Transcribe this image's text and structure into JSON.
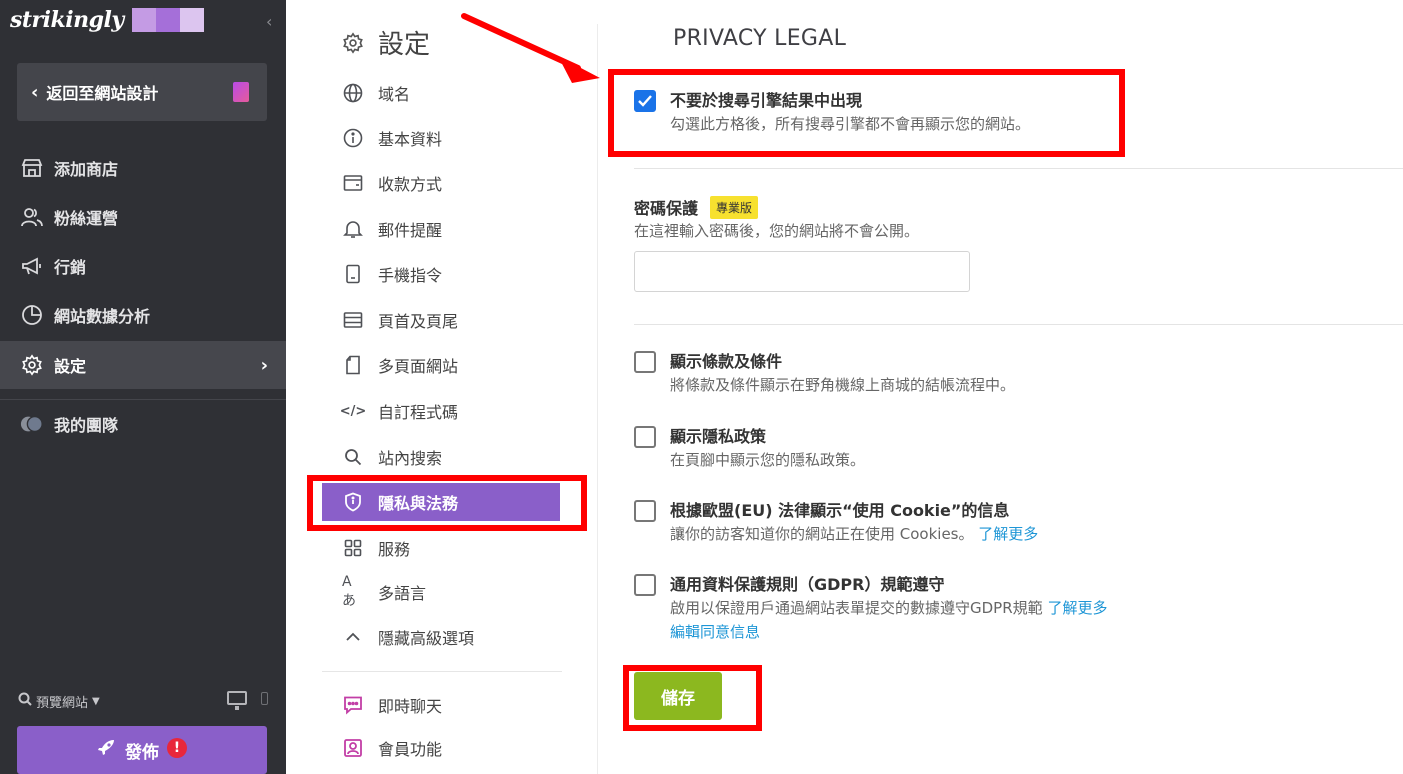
{
  "brand": {
    "logo_text": "strikingly",
    "logo_colors": [
      "#c49be4",
      "#a56fd9",
      "#dcc5ef"
    ]
  },
  "sidebar": {
    "back_label": "返回至網站設計",
    "items": [
      {
        "label": "添加商店",
        "icon": "store-icon"
      },
      {
        "label": "粉絲運營",
        "icon": "audience-icon"
      },
      {
        "label": "行銷",
        "icon": "megaphone-icon"
      },
      {
        "label": "網站數據分析",
        "icon": "pie-chart-icon"
      },
      {
        "label": "設定",
        "icon": "gear-icon",
        "active": true
      },
      {
        "label": "我的團隊",
        "icon": "team-avatar-icon"
      }
    ],
    "preview_label": "預覽網站",
    "publish_label": "發佈",
    "publish_alert": "!"
  },
  "settings_menu": {
    "title": "設定",
    "items": [
      {
        "label": "域名",
        "icon": "globe-icon"
      },
      {
        "label": "基本資料",
        "icon": "info-icon"
      },
      {
        "label": "收款方式",
        "icon": "wallet-icon"
      },
      {
        "label": "郵件提醒",
        "icon": "bell-icon"
      },
      {
        "label": "手機指令",
        "icon": "mobile-icon"
      },
      {
        "label": "頁首及頁尾",
        "icon": "header-footer-icon"
      },
      {
        "label": "多頁面網站",
        "icon": "pages-icon"
      },
      {
        "label": "自訂程式碼",
        "icon": "code-icon",
        "glyph": "</>"
      },
      {
        "label": "站內搜索",
        "icon": "search-icon"
      },
      {
        "label": "隱私與法務",
        "icon": "shield-icon",
        "active": true
      },
      {
        "label": "服務",
        "icon": "grid-icon"
      },
      {
        "label": "多語言",
        "icon": "language-icon",
        "glyph": "Aあ"
      },
      {
        "label": "隱藏高級選項",
        "icon": "chevron-up-icon",
        "glyph": "^"
      },
      {
        "label": "即時聊天",
        "icon": "chat-icon"
      },
      {
        "label": "會員功能",
        "icon": "member-icon"
      }
    ]
  },
  "main": {
    "section_title": "PRIVACY LEGAL",
    "search_opt": {
      "title": "不要於搜尋引擎結果中出現",
      "desc": "勾選此方格後，所有搜尋引擎都不會再顯示您的網站。",
      "checked": true
    },
    "password": {
      "label": "密碼保護",
      "badge": "專業版",
      "desc": "在這裡輸入密碼後，您的網站將不會公開。",
      "value": "",
      "placeholder": ""
    },
    "terms_opt": {
      "title": "顯示條款及條件",
      "desc": "將條款及條件顯示在野角機線上商城的結帳流程中。",
      "checked": false
    },
    "privacy_opt": {
      "title": "顯示隱私政策",
      "desc": "在頁腳中顯示您的隱私政策。",
      "checked": false
    },
    "cookie_opt": {
      "title": "根據歐盟(EU) 法律顯示“使用 Cookie”的信息",
      "desc": "讓你的訪客知道你的網站正在使用 Cookies。",
      "link": "了解更多",
      "checked": false
    },
    "gdpr_opt": {
      "title": "通用資料保護規則（GDPR）規範遵守",
      "desc": "啟用以保證用戶通過網站表單提交的數據遵守GDPR規範",
      "link": "了解更多",
      "link2": "編輯同意信息",
      "checked": false
    },
    "save_label": "儲存"
  },
  "colors": {
    "sidebar_bg": "#2f3035",
    "accent_purple": "#8a5fc9",
    "save_green": "#8cb81f",
    "checkbox_blue": "#1a73e8",
    "annotation_red": "#ff0000",
    "link_blue": "#1e96d6"
  }
}
